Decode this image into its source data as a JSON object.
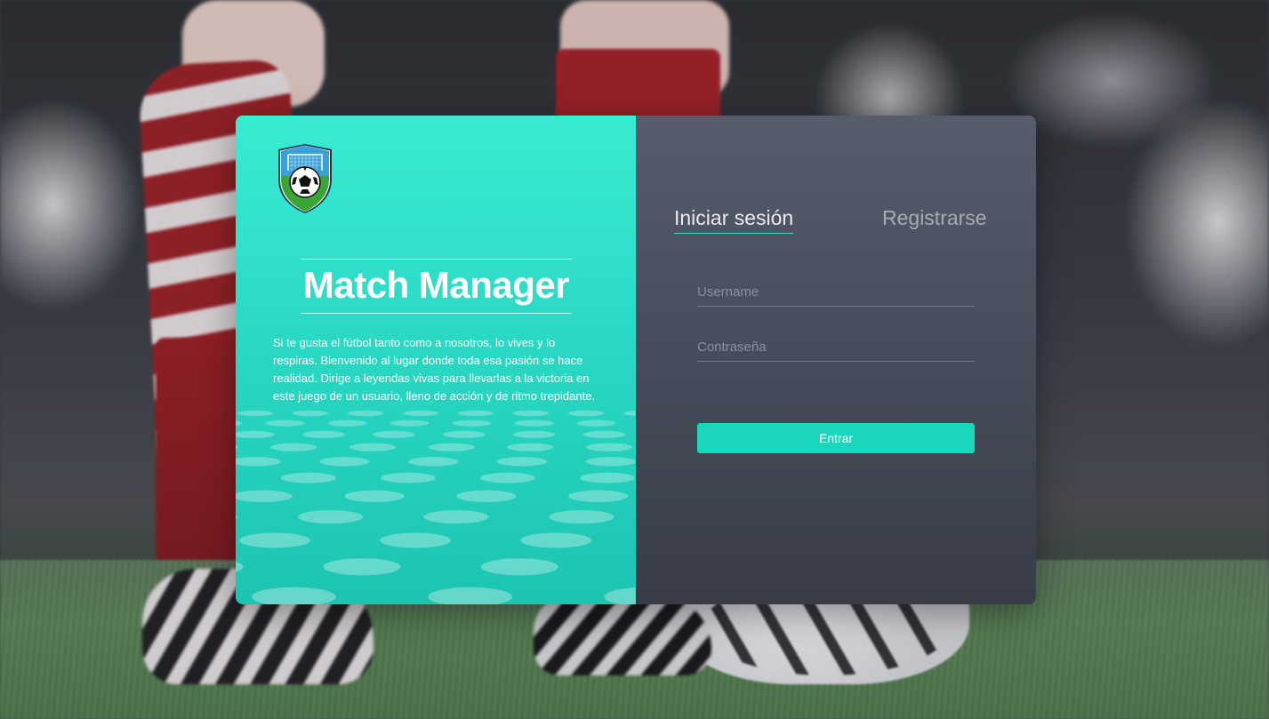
{
  "app": {
    "title": "Match Manager",
    "description": "Si te gusta el fútbol tanto como a nosotros, lo vives y lo respiras. Bienvenido al lugar donde toda esa pasión se hace realidad. Dirige a leyendas vivas para llevarlas a la victoria en este juego de un usuario, lleno de acción y de ritmo trepidante."
  },
  "auth": {
    "tabs": {
      "login": "Iniciar sesión",
      "register": "Registrarse"
    },
    "active_tab": "login",
    "username": {
      "placeholder": "Username",
      "value": ""
    },
    "password": {
      "placeholder": "Contraseña",
      "value": ""
    },
    "submit_label": "Entrar"
  },
  "icons": {
    "logo": "soccer-shield-logo"
  },
  "colors": {
    "accent": "#1ad6bd",
    "left_panel_top": "#3aebd3",
    "left_panel_bottom": "#1cc4b1",
    "right_panel_top": "#565c6c",
    "right_panel_bottom": "#383c48"
  }
}
